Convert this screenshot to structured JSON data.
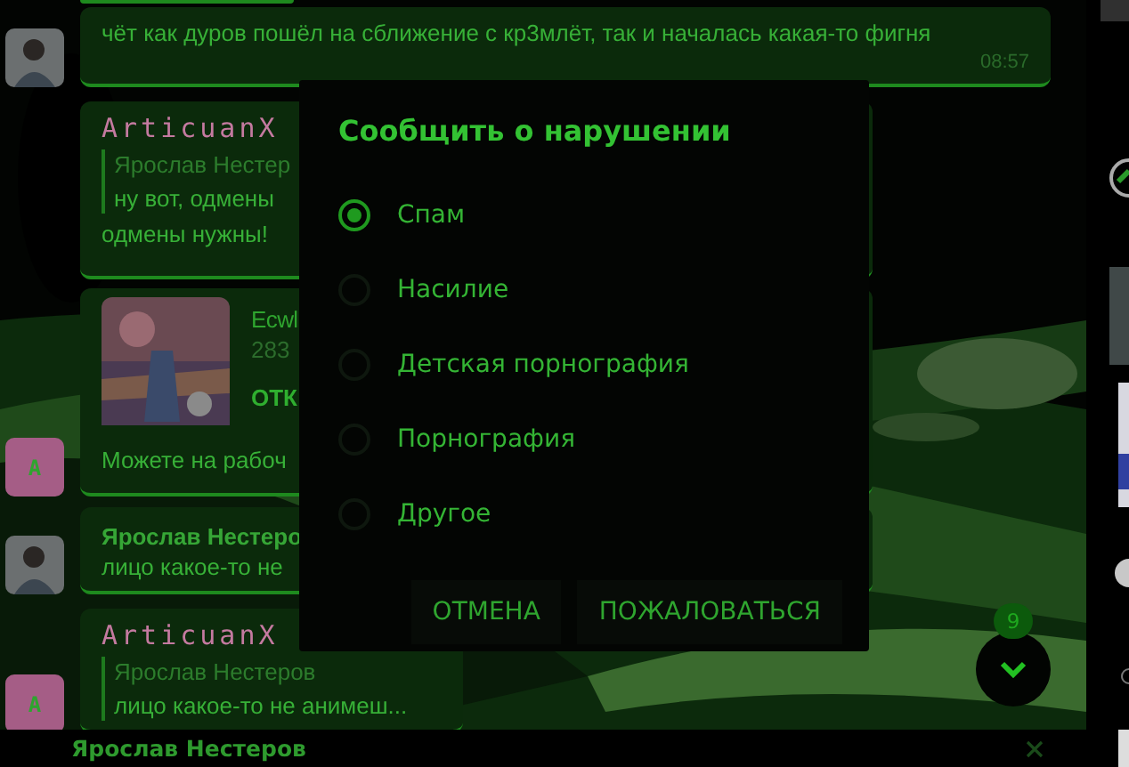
{
  "chat": {
    "messages": [
      {
        "kind": "text",
        "text": "чёт как дуров пошёл на сближение с кр3млёт, так и началась какая-то фигня",
        "time": "08:57"
      },
      {
        "kind": "reply",
        "sender": "ArticuanX",
        "quote_author": "Ярослав Нестер",
        "quote_text": "ну вот, одмены",
        "text": "одмены нужны!"
      },
      {
        "kind": "link",
        "avatar": {
          "kind": "letter",
          "letter": "A"
        },
        "site": "Ecwl",
        "detail": "283",
        "action": "ОТК",
        "text": "Можете на рабоч"
      },
      {
        "kind": "text",
        "sender": "Ярослав Нестеро",
        "text": "лицо какое-то не"
      },
      {
        "kind": "reply",
        "avatar": {
          "kind": "letter",
          "letter": "A"
        },
        "sender": "ArticuanX",
        "quote_author": "Ярослав Нестеров",
        "quote_text": "лицо какое-то не анимеш..."
      }
    ],
    "unread_badge": "9",
    "reply_bar": {
      "author": "Ярослав Нестеров"
    }
  },
  "dialog": {
    "title": "Сообщить о нарушении",
    "options": [
      {
        "label": "Спам",
        "selected": true
      },
      {
        "label": "Насилие",
        "selected": false
      },
      {
        "label": "Детская порнография",
        "selected": false
      },
      {
        "label": "Порнография",
        "selected": false
      },
      {
        "label": "Другое",
        "selected": false
      }
    ],
    "buttons": [
      "ОТМЕНА",
      "ПОЖАЛОВАТЬСЯ"
    ]
  }
}
